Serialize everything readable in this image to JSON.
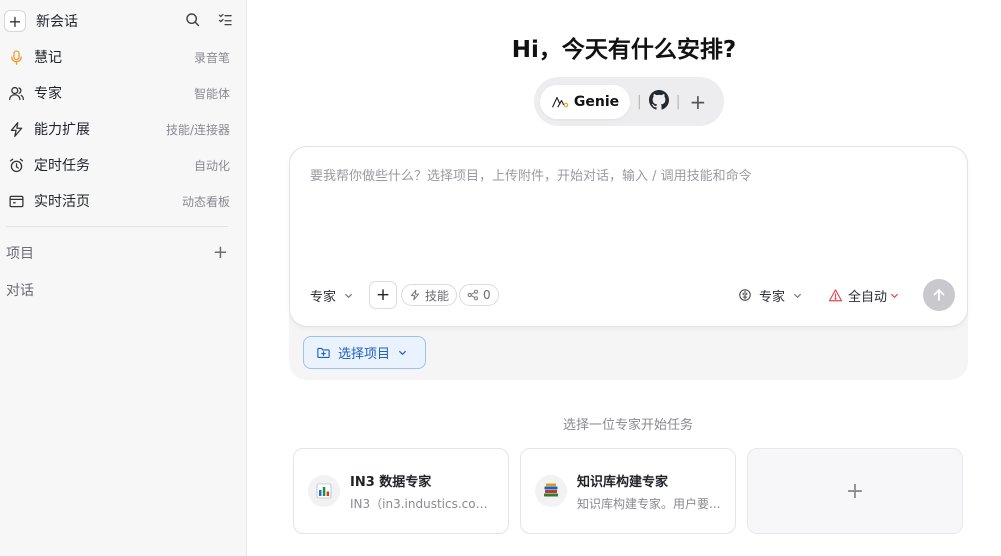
{
  "sidebar": {
    "new_chat": "新会话",
    "items": [
      {
        "label": "慧记",
        "tag": "录音笔",
        "icon": "microphone-icon"
      },
      {
        "label": "专家",
        "tag": "智能体",
        "icon": "user-icon"
      },
      {
        "label": "能力扩展",
        "tag": "技能/连接器",
        "icon": "bolt-icon"
      },
      {
        "label": "定时任务",
        "tag": "自动化",
        "icon": "alarm-clock-icon"
      },
      {
        "label": "实时活页",
        "tag": "动态看板",
        "icon": "browser-window-icon"
      }
    ],
    "projects_label": "项目",
    "chats_label": "对话"
  },
  "main": {
    "greeting": "Hi，今天有什么安排?",
    "switcher": {
      "genie_label": "Genie",
      "separator": "|"
    },
    "composer": {
      "placeholder": "要我帮你做些什么？选择项目，上传附件，开始对话，输入 / 调用技能和命令",
      "mode_label": "专家",
      "skills_label": "技能",
      "connectors_count": "0",
      "model_label": "专家",
      "autonomy_label": "全自动"
    },
    "select_project": "选择项目",
    "hint": "选择一位专家开始任务",
    "experts": [
      {
        "title": "IN3 数据专家",
        "desc": "IN3（in3.industics.com...",
        "icon": "bar-chart-icon"
      },
      {
        "title": "知识库构建专家",
        "desc": "知识库构建专家。用户要...",
        "icon": "books-icon"
      }
    ]
  },
  "colors": {
    "accent_blue": "#1f5fbf",
    "warning_red": "#e5484d",
    "mic_orange": "#e8a13a"
  }
}
